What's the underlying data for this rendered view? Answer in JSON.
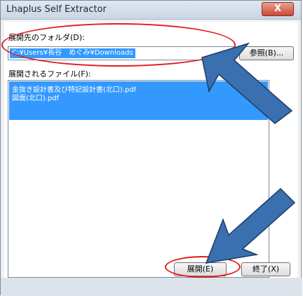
{
  "window": {
    "title": "Lhaplus Self Extractor",
    "close_label": "X"
  },
  "dest": {
    "label": "展開先のフォルダ(D):",
    "path": "C:¥Users¥長谷　めぐみ¥Downloads",
    "browse_label": "参照(B)..."
  },
  "files": {
    "label": "展開されるファイル(F):",
    "items": [
      "金抜き設計書及び特記設計書(北口).pdf",
      "図面(北口).pdf"
    ]
  },
  "buttons": {
    "extract_label": "展開(E)",
    "exit_label": "終了(X)"
  },
  "colors": {
    "selection": "#3399ff",
    "annotation_red": "#e01b1b",
    "arrow_blue": "#3a6fb0"
  }
}
